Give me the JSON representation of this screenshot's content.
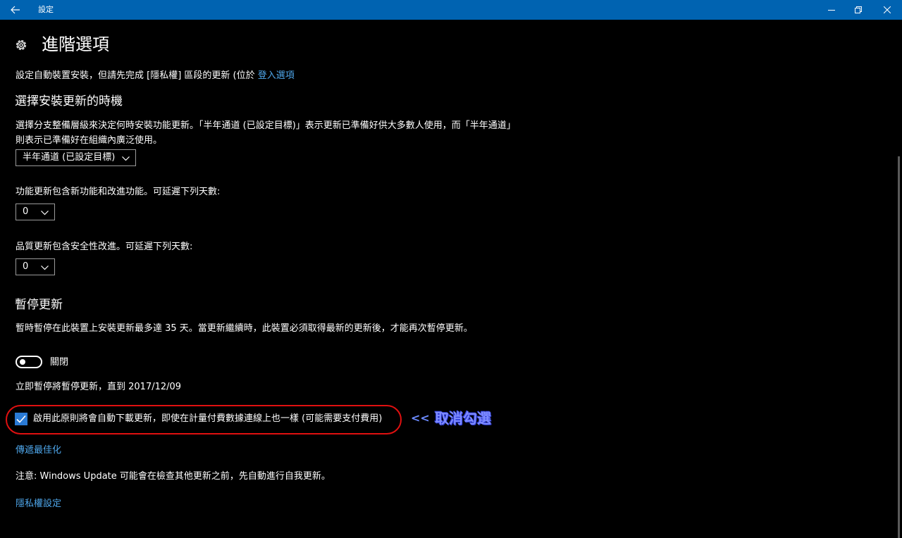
{
  "window": {
    "title": "設定",
    "accent": "#0063b1",
    "icons": [
      "back-arrow-icon",
      "minimize-icon",
      "maximize-icon",
      "close-icon"
    ]
  },
  "page": {
    "icon": "gear-icon",
    "title": "進階選項",
    "intro_text": "設定自動裝置安裝，但請先完成 [隱私權] 區段的更新 (位於",
    "intro_link": "登入選項"
  },
  "branch": {
    "heading": "選擇安裝更新的時機",
    "description": "選擇分支整備層級來決定何時安裝功能更新。「半年通道 (已設定目標)」表示更新已準備好供大多數人使用，而「半年通道」則表示已準備好在組織內廣泛使用。",
    "selected": "半年通道 (已設定目標)"
  },
  "feature_defer": {
    "label": "功能更新包含新功能和改進功能。可延遲下列天數:",
    "value": "0"
  },
  "quality_defer": {
    "label": "品質更新包含安全性改進。可延遲下列天數:",
    "value": "0"
  },
  "pause": {
    "heading": "暫停更新",
    "description": "暫時暫停在此裝置上安裝更新最多達 35 天。當更新繼續時，此裝置必須取得最新的更新後，才能再次暫停更新。",
    "toggle_state": "off",
    "toggle_label": "關閉",
    "until_text": "立即暫停將暫停更新，直到 2017/12/09"
  },
  "metered": {
    "checked": true,
    "label": "啟用此原則將會自動下載更新，即使在計量付費數據連線上也一樣 (可能需要支付費用)",
    "highlight_color": "#e01010"
  },
  "annotation": {
    "arrow": "<<",
    "text": "取消勾選"
  },
  "links": {
    "delivery": "傳遞最佳化",
    "privacy": "隱私權設定"
  },
  "note": "注意: Windows Update 可能會在檢查其他更新之前，先自動進行自我更新。"
}
